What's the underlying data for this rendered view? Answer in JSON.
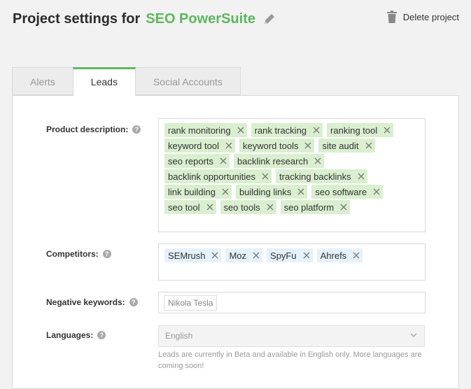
{
  "header": {
    "title": "Project settings for",
    "project_name": "SEO PowerSuite",
    "delete_label": "Delete project"
  },
  "tabs": [
    {
      "label": "Alerts",
      "active": false
    },
    {
      "label": "Leads",
      "active": true
    },
    {
      "label": "Social Accounts",
      "active": false
    }
  ],
  "form": {
    "product_description": {
      "label": "Product description:",
      "tags": [
        "rank monitoring",
        "rank tracking",
        "ranking tool",
        "keyword tool",
        "keyword tools",
        "site audit",
        "seo reports",
        "backlink research",
        "backlink opportunities",
        "tracking backlinks",
        "link building",
        "building links",
        "seo software",
        "seo tool",
        "seo tools",
        "seo platform"
      ]
    },
    "competitors": {
      "label": "Competitors:",
      "tags": [
        "SEMrush",
        "Moz",
        "SpyFu",
        "Ahrefs"
      ]
    },
    "negative_keywords": {
      "label": "Negative keywords:",
      "placeholder": "Nikola Tesla"
    },
    "languages": {
      "label": "Languages:",
      "value": "English",
      "note": "Leads are currently in Beta and available in English only. More languages are coming soon!"
    }
  },
  "colors": {
    "accent": "#5cb85c",
    "tag_green": "#d9efcf",
    "tag_blue": "#e5f1fb"
  }
}
